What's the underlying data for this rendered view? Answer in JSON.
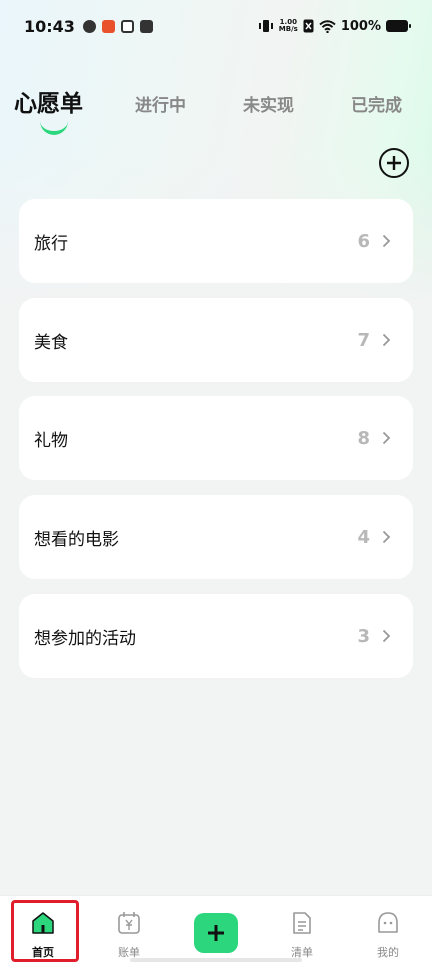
{
  "status_bar": {
    "time": "10:43",
    "network_speed_top": "1.00",
    "network_speed_bottom": "MB/s",
    "battery_text": "100%"
  },
  "tabs": [
    {
      "label": "心愿单",
      "active": true
    },
    {
      "label": "进行中",
      "active": false
    },
    {
      "label": "未实现",
      "active": false
    },
    {
      "label": "已完成",
      "active": false
    }
  ],
  "add_icon": "plus-circle-icon",
  "categories": [
    {
      "label": "旅行",
      "count": "6"
    },
    {
      "label": "美食",
      "count": "7"
    },
    {
      "label": "礼物",
      "count": "8"
    },
    {
      "label": "想看的电影",
      "count": "4"
    },
    {
      "label": "想参加的活动",
      "count": "3"
    }
  ],
  "bottom_nav": {
    "home": "首页",
    "ledger": "账单",
    "list": "清单",
    "mine": "我的"
  },
  "colors": {
    "accent": "#2bd67c",
    "highlight": "#e01d2b"
  }
}
